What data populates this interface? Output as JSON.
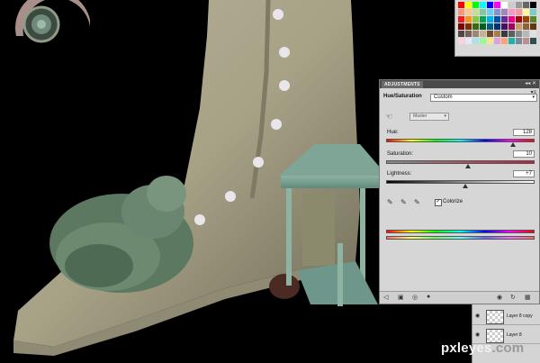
{
  "adjustments": {
    "tab_label": "ADJUSTMENTS",
    "header_icons": "◂◂ ✕",
    "menu_icon": "▾≡",
    "panel_title": "Hue/Saturation",
    "preset_value": "Custom",
    "channel_value": "Master",
    "hue_label": "Hue:",
    "hue_value": "128",
    "saturation_label": "Saturation:",
    "saturation_value": "10",
    "lightness_label": "Lightness:",
    "lightness_value": "+7",
    "colorize_label": "Colorize",
    "colorize_checked": "✓"
  },
  "layers": {
    "items": [
      {
        "name": "Layer 8 copy"
      },
      {
        "name": "Layer 8"
      }
    ]
  },
  "watermark": {
    "brand": "pxleyes",
    "tld": ".com"
  },
  "colors": {
    "panel_bg": "#d6d6d6",
    "canvas_bg": "#000000"
  }
}
